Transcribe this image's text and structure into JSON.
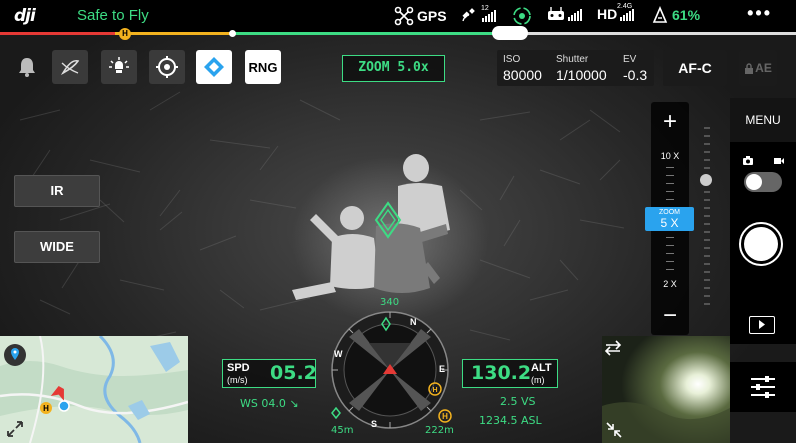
{
  "app": {
    "logo": "dji",
    "flight_status": "Safe to Fly"
  },
  "status_bar": {
    "gps_label": "GPS",
    "satellite_count": "12",
    "hd_label": "HD",
    "hd_band": "2.4G",
    "battery_percent": "61%",
    "more_label": "•••",
    "icons": [
      "drone-icon",
      "satellite-icon",
      "signal-icon",
      "obstacle-sensing-icon",
      "remote-controller-icon",
      "battery-icon"
    ]
  },
  "progress": {
    "home_marker": "H"
  },
  "toolbar": {
    "buttons": [
      "notification-bell-icon",
      "flight-mode-icon",
      "spotlight-icon",
      "target-icon",
      "beacon-icon"
    ],
    "rng_label": "RNG",
    "zoom_label": "ZOOM 5.0x"
  },
  "exposure": {
    "iso_label": "ISO",
    "iso_value": "80000",
    "shutter_label": "Shutter",
    "shutter_value": "1/10000",
    "ev_label": "EV",
    "ev_value": "-0.3",
    "focus_mode": "AF-C",
    "ae_lock_label": "AE"
  },
  "camera_mode_buttons": {
    "ir_label": "IR",
    "wide_label": "WIDE"
  },
  "zoom_slider": {
    "plus_label": "+",
    "minus_label": "−",
    "max_label": "10 X",
    "current_caption": "ZOOM",
    "current_value": "5 X",
    "min_label": "2 X"
  },
  "right_panel": {
    "menu_label": "MENU"
  },
  "telemetry": {
    "spd_label": "SPD",
    "spd_unit": "(m/s)",
    "spd_value": "05.2",
    "ws_text": "WS 04.0 ↘",
    "alt_label": "ALT",
    "alt_unit": "(m)",
    "alt_value": "130.2",
    "vs_text": "2.5 VS",
    "asl_text": "1234.5 ASL",
    "heading_value": "340",
    "distance_left": "45m",
    "distance_home": "222m"
  },
  "compass": {
    "labels": [
      "N",
      "E",
      "S",
      "W"
    ]
  },
  "colors": {
    "accent_green": "#3ddc84",
    "zoom_blue": "#2aa3ee",
    "home_yellow": "#f2b21f",
    "warning_red": "#e53935"
  }
}
